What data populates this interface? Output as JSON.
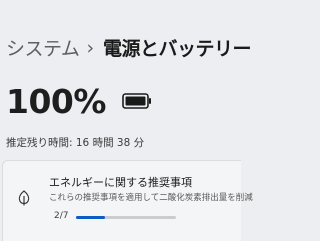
{
  "breadcrumb": {
    "parent": "システム",
    "separator": "›",
    "current": "電源とバッテリー"
  },
  "battery": {
    "percent": "100%",
    "level": 1.0,
    "icon": "battery-full-icon",
    "remaining": "推定残り時間: 16 時間 38 分"
  },
  "recommendation": {
    "icon": "leaf-icon",
    "title": "エネルギーに関する推奨事項",
    "description": "これらの推奨事項を適用して二酸化炭素排出量を削減",
    "page": "2/7",
    "progress": 0.285,
    "accent": "#0b5cc4"
  }
}
